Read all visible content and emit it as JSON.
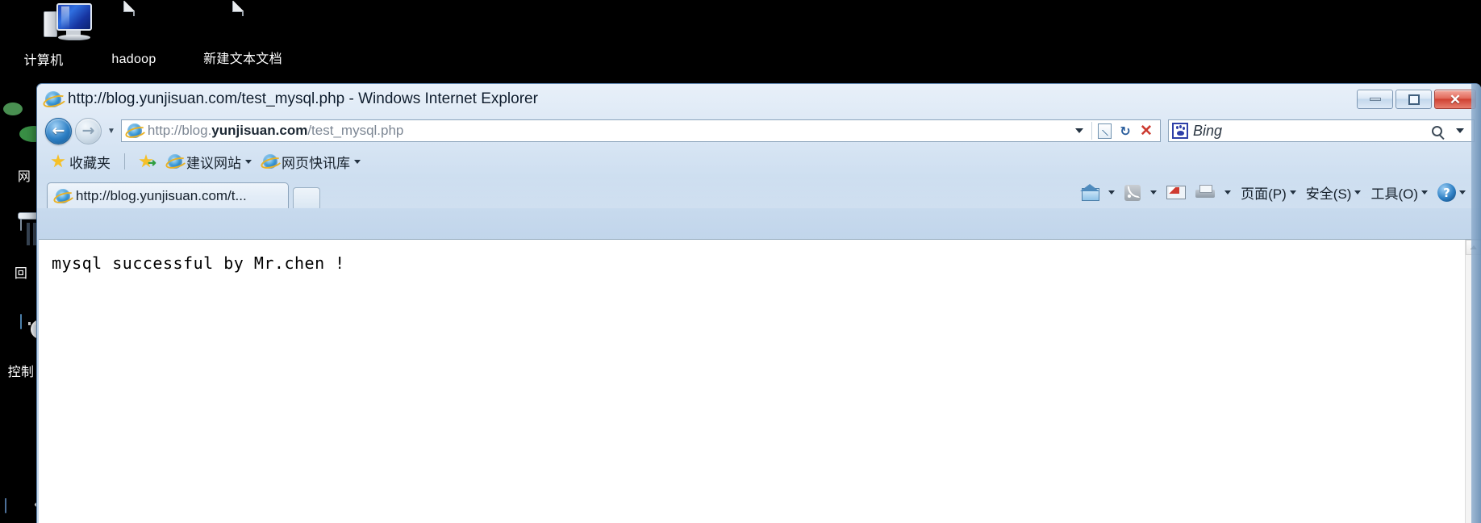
{
  "desktop": {
    "background_color": "#000000",
    "icons": [
      {
        "name": "computer",
        "label": "计算机",
        "icon": "computer-icon"
      },
      {
        "name": "hadoop",
        "label": "hadoop",
        "icon": "text-document-icon"
      },
      {
        "name": "new-text-document",
        "label": "新建文本文档",
        "icon": "text-document-icon"
      }
    ],
    "left_partial_icons": [
      {
        "name": "network",
        "label": "网",
        "icon": "globe-icon"
      },
      {
        "name": "recycle-bin",
        "label": "回",
        "icon": "recycle-bin-icon"
      },
      {
        "name": "control-panel",
        "label": "控制",
        "icon": "control-panel-icon"
      },
      {
        "name": "shortcut",
        "label": "",
        "icon": "shortcut-arrow-icon"
      }
    ]
  },
  "window": {
    "title": "http://blog.yunjisuan.com/test_mysql.php - Windows Internet Explorer",
    "app_icon": "ie-logo-icon",
    "controls": {
      "minimize": "minimize-button",
      "maximize": "maximize-button",
      "close": "close-button",
      "close_glyph": "✕"
    },
    "accent_close_color": "#cf4132",
    "frame_color": "#b6cde6"
  },
  "navbar": {
    "back_label": "←",
    "forward_label": "→",
    "history_caret": "▼",
    "address": {
      "icon": "ie-logo-icon",
      "prefix": "http://blog.",
      "domain": "yunjisuan.com",
      "suffix": "/test_mysql.php",
      "full_url": "http://blog.yunjisuan.com/test_mysql.php"
    },
    "tools": {
      "dropdown": "address-dropdown",
      "compatibility": "compatibility-view-button",
      "refresh": "refresh-button",
      "refresh_glyph": "↻",
      "stop": "stop-button",
      "stop_glyph": "✕"
    },
    "search": {
      "provider_icon": "baidu-paw-icon",
      "placeholder": "Bing",
      "value": "",
      "search_glyph": "search-icon",
      "dropdown": "search-provider-dropdown"
    }
  },
  "favorites_bar": {
    "favorites_label": "收藏夹",
    "items": [
      {
        "label": "建议网站",
        "icon": "ie-logo-icon",
        "has_caret": true
      },
      {
        "label": "网页快讯库",
        "icon": "ie-logo-icon",
        "has_caret": true
      }
    ],
    "add_to_favorites": "add-to-favorites-button"
  },
  "tabs": {
    "items": [
      {
        "label": "http://blog.yunjisuan.com/t...",
        "icon": "ie-logo-icon",
        "active": true
      }
    ],
    "new_tab_label": ""
  },
  "command_bar": {
    "items": [
      {
        "name": "home-button",
        "icon": "home-icon",
        "label": "",
        "caret": true
      },
      {
        "name": "feeds-button",
        "icon": "rss-icon",
        "label": "",
        "caret": true
      },
      {
        "name": "read-mail-button",
        "icon": "mail-icon",
        "label": "",
        "caret": false
      },
      {
        "name": "print-button",
        "icon": "printer-icon",
        "label": "",
        "caret": true
      },
      {
        "name": "page-menu",
        "icon": "",
        "label": "页面(P)",
        "caret": true
      },
      {
        "name": "safety-menu",
        "icon": "",
        "label": "安全(S)",
        "caret": true
      },
      {
        "name": "tools-menu",
        "icon": "",
        "label": "工具(O)",
        "caret": true
      },
      {
        "name": "help-button",
        "icon": "help-icon",
        "label": "",
        "caret": true
      }
    ]
  },
  "page": {
    "body_text": "mysql successful by Mr.chen !",
    "background_color": "#ffffff",
    "text_color": "#000000"
  },
  "scrollbar": {
    "up_arrow": "▲",
    "down_arrow": "▼"
  }
}
